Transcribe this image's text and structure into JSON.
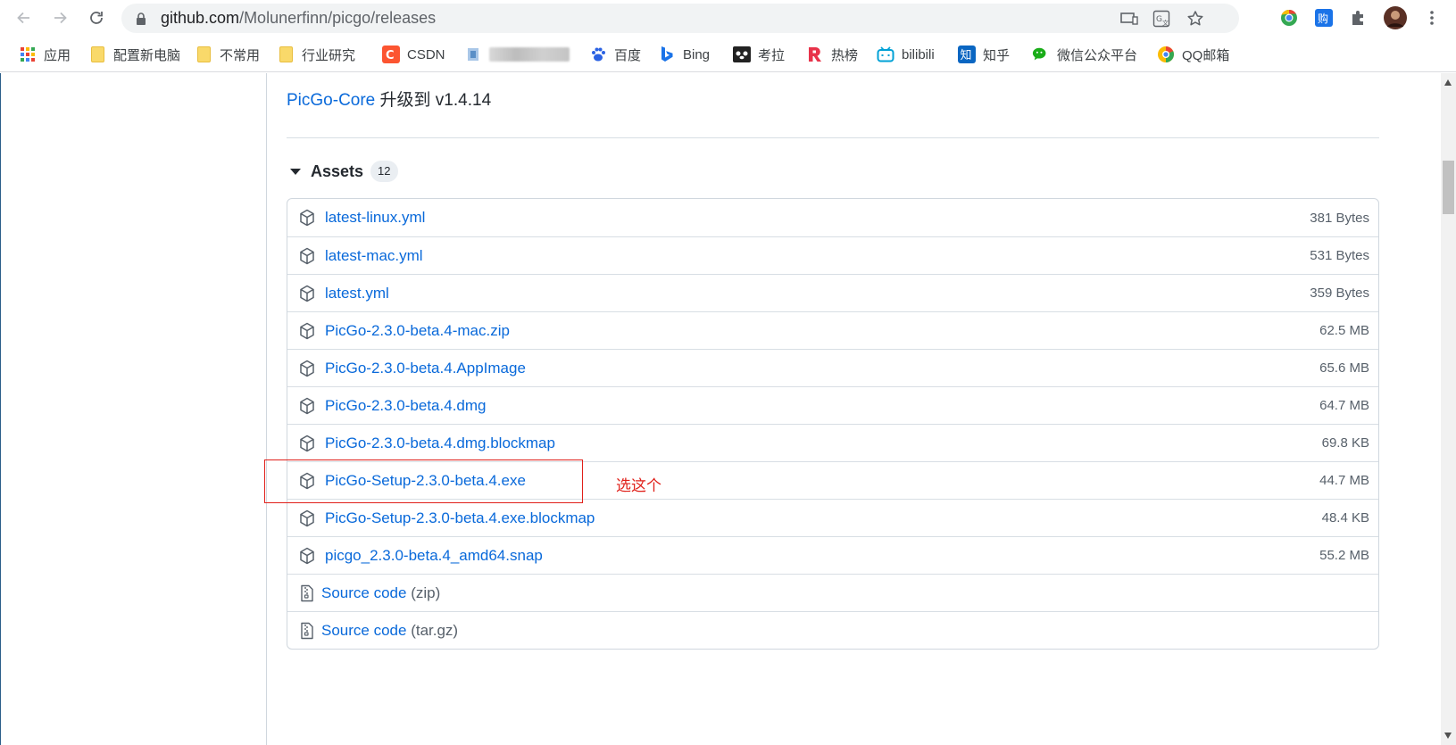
{
  "browser": {
    "url_host": "github.com",
    "url_path": "/Molunerfinn/picgo/releases"
  },
  "bookmarks": [
    {
      "label": "应用",
      "icon": "apps-grid-icon"
    },
    {
      "label": "配置新电脑",
      "icon": "folder-icon"
    },
    {
      "label": "不常用",
      "icon": "folder-icon"
    },
    {
      "label": "行业研究",
      "icon": "folder-icon"
    },
    {
      "label": "CSDN",
      "icon": "csdn-icon"
    },
    {
      "label": "",
      "icon": "blurred-bookmark-icon"
    },
    {
      "label": "百度",
      "icon": "baidu-paw-icon"
    },
    {
      "label": "Bing",
      "icon": "bing-icon"
    },
    {
      "label": "考拉",
      "icon": "koala-icon"
    },
    {
      "label": "热榜",
      "icon": "rebang-icon"
    },
    {
      "label": "bilibili",
      "icon": "bilibili-icon"
    },
    {
      "label": "知乎",
      "icon": "zhihu-icon"
    },
    {
      "label": "微信公众平台",
      "icon": "wechat-icon"
    },
    {
      "label": "QQ邮箱",
      "icon": "qqmail-icon"
    }
  ],
  "release": {
    "core_link": "PicGo-Core",
    "core_text": " 升级到 v1.4.14"
  },
  "assets": {
    "title": "Assets",
    "count": "12",
    "files": [
      {
        "name": "latest-linux.yml",
        "size": "381 Bytes"
      },
      {
        "name": "latest-mac.yml",
        "size": "531 Bytes"
      },
      {
        "name": "latest.yml",
        "size": "359 Bytes"
      },
      {
        "name": "PicGo-2.3.0-beta.4-mac.zip",
        "size": "62.5 MB"
      },
      {
        "name": "PicGo-2.3.0-beta.4.AppImage",
        "size": "65.6 MB"
      },
      {
        "name": "PicGo-2.3.0-beta.4.dmg",
        "size": "64.7 MB"
      },
      {
        "name": "PicGo-2.3.0-beta.4.dmg.blockmap",
        "size": "69.8 KB"
      },
      {
        "name": "PicGo-Setup-2.3.0-beta.4.exe",
        "size": "44.7 MB"
      },
      {
        "name": "PicGo-Setup-2.3.0-beta.4.exe.blockmap",
        "size": "48.4 KB"
      },
      {
        "name": "picgo_2.3.0-beta.4_amd64.snap",
        "size": "55.2 MB"
      }
    ],
    "source": [
      {
        "name": "Source code",
        "ext": "(zip)"
      },
      {
        "name": "Source code",
        "ext": "(tar.gz)"
      }
    ]
  },
  "annotation": {
    "text": "选这个",
    "color": "#e0201a"
  },
  "colors": {
    "link": "#0969da",
    "muted": "#57606a",
    "border": "#d0d7de"
  }
}
